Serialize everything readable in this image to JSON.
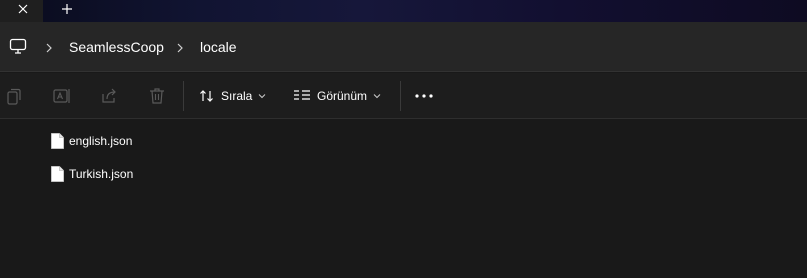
{
  "window": {
    "close_tab_icon": "close-icon",
    "new_tab_icon": "plus-icon"
  },
  "breadcrumb": {
    "root_icon": "monitor-icon",
    "items": [
      {
        "label": "SeamlessCoop"
      },
      {
        "label": "locale"
      }
    ]
  },
  "toolbar": {
    "disabled_actions": [
      "copy-icon",
      "rename-icon",
      "share-icon",
      "delete-icon"
    ],
    "sort_label": "Sırala",
    "view_label": "Görünüm",
    "more_icon": "more-icon"
  },
  "files": [
    {
      "name": "english.json",
      "icon": "file-icon"
    },
    {
      "name": "Turkish.json",
      "icon": "file-icon"
    }
  ],
  "colors": {
    "background": "#191919",
    "address_bar": "#262626",
    "toolbar": "#1d1d1d",
    "text": "#ffffff",
    "disabled_icon": "#5a5a5a"
  }
}
